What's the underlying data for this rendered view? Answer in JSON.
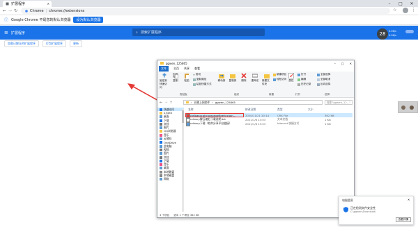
{
  "chrome": {
    "tab_title": "扩展程序",
    "address_prefix": "Chrome",
    "address_url": "chrome://extensions",
    "info_text": "Google Chrome 不是您的默认浏览器",
    "info_button": "设为默认浏览器",
    "window_min": "–",
    "window_max": "□",
    "window_close": "✕"
  },
  "extensions": {
    "header_title": "扩展程序",
    "search_placeholder": "搜索扩展程序",
    "speed_value": "28",
    "speed_sub1": "0.0K/s",
    "speed_sub2": "0.0K/s",
    "dev_buttons": [
      "加载已解压的扩展程序",
      "打包扩展程序",
      "更新"
    ]
  },
  "explorer": {
    "title": "ggwen_125865",
    "tabs": [
      "文件",
      "主页",
      "共享",
      "查看"
    ],
    "file_tab": "文件",
    "ribbon": {
      "pin_label": "固定到快速访问",
      "copy_label": "复制",
      "paste_label": "粘贴",
      "cut_label": "剪切",
      "copy_path_label": "复制路径",
      "paste_shortcut_label": "粘贴快捷方式",
      "move_to_label": "移动到",
      "copy_to_label": "复制到",
      "delete_label": "删除",
      "rename_label": "重命名",
      "new_folder_label": "新建文件夹",
      "new_item_label": "新建项目",
      "easy_access_label": "轻松访问",
      "properties_label": "属性",
      "open_label": "打开",
      "edit_label": "编辑",
      "history_label": "历史记录",
      "select_all_label": "全部选择",
      "select_none_label": "全部取消",
      "invert_label": "反向选择",
      "group_clipboard": "剪贴板",
      "group_organize": "组织",
      "group_new": "新建",
      "group_open": "打开",
      "group_select": "选择"
    },
    "address": {
      "parts": [
        "谷歌上网助手",
        "ggwen_125865"
      ],
      "search_placeholder": "搜索\"ggwen_12...\""
    },
    "nav_items": [
      {
        "label": "快速访问",
        "selected": true
      },
      {
        "label": "23450",
        "selected": false
      },
      {
        "label": "桌面",
        "selected": false
      },
      {
        "label": "下载",
        "selected": false
      },
      {
        "label": "文档",
        "selected": false
      },
      {
        "label": "图片",
        "selected": false
      },
      {
        "label": "QQ浏览器",
        "selected": false
      },
      {
        "label": "音乐",
        "selected": false
      },
      {
        "label": "云储存",
        "selected": false
      },
      {
        "label": "OneDrive",
        "selected": false
      },
      {
        "label": "此电脑",
        "selected": false
      },
      {
        "label": "视频",
        "selected": false
      },
      {
        "label": "图片",
        "selected": false
      },
      {
        "label": "文档",
        "selected": false
      },
      {
        "label": "下载",
        "selected": false
      },
      {
        "label": "音乐",
        "selected": false
      },
      {
        "label": "桌面",
        "selected": false
      },
      {
        "label": "本地磁盘",
        "selected": false
      },
      {
        "label": "本地磁盘",
        "selected": false
      },
      {
        "label": "网络",
        "selected": false
      }
    ],
    "columns": [
      "名称",
      "修改日期",
      "类型",
      "大小"
    ],
    "files": [
      {
        "name": "cielbaaccahcacephgefleehncjoin...",
        "date": "2020/11/21 20:14",
        "type": "CRX File",
        "size": "362 KB",
        "selected": true
      },
      {
        "name": "ccfanry解压缩后下载说明.txt",
        "date": "2021/1/6 13:03",
        "type": "文本文档",
        "size": "1 KB",
        "selected": false
      },
      {
        "name": "ccfanry下载（软件分享平台链接）",
        "date": "2021/1/6 13:03",
        "type": "Internet 快捷方式",
        "size": "1 KB",
        "selected": false
      }
    ],
    "status": {
      "items": "3 个项目",
      "selected": "选中 1 个项目 362 KB"
    }
  },
  "notification": {
    "title": "电脑管家",
    "message": "正在检测文件安全性",
    "path": "C:\\ggwen\\Download\\",
    "button": "查看详情"
  },
  "colors": {
    "chrome_blue": "#1a73e8",
    "highlight_red": "#e53935",
    "selection_blue": "#cce8ff"
  }
}
